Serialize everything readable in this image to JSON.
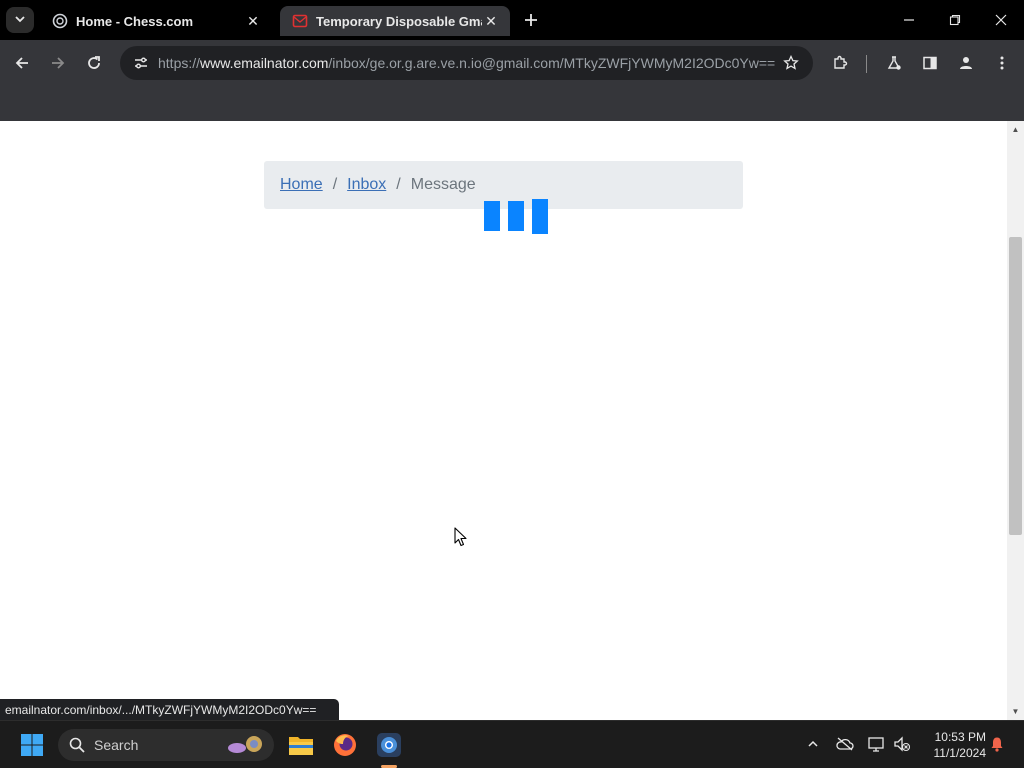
{
  "browser": {
    "tabs": [
      {
        "title": "Home - Chess.com",
        "active": false
      },
      {
        "title": "Temporary Disposable Gmail |",
        "active": true
      }
    ],
    "url": {
      "scheme": "https://",
      "host": "www.emailnator.com",
      "path": "/inbox/ge.or.g.are.ve.n.io@gmail.com/MTkyZWFjYWMyM2I2ODc0Yw=="
    },
    "status_url": "emailnator.com/inbox/.../MTkyZWFjYWMyM2I2ODc0Yw=="
  },
  "page": {
    "breadcrumb": {
      "home": "Home",
      "separator": "/",
      "inbox": "Inbox",
      "current": "Message"
    },
    "loader_color": "#0a84ff"
  },
  "taskbar": {
    "search_label": "Search",
    "time": "10:53 PM",
    "date": "11/1/2024"
  }
}
